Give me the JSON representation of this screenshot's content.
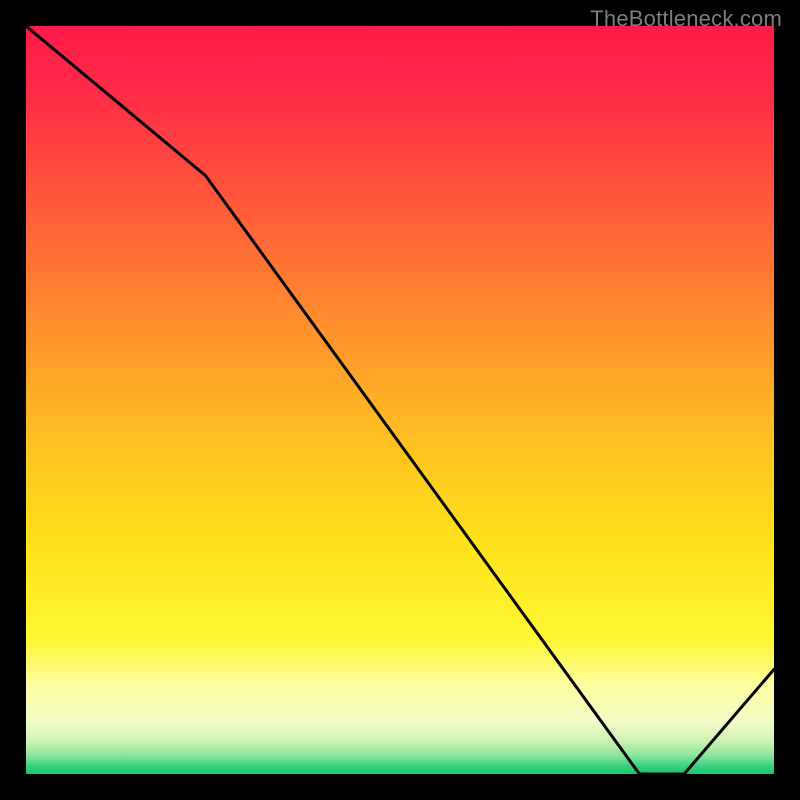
{
  "watermark": "TheBottleneck.com",
  "annotation_label": "",
  "colors": {
    "frame": "#000000",
    "curve": "#000000",
    "gradient_stops": [
      {
        "offset": 0.0,
        "color": "#ff1a4b"
      },
      {
        "offset": 0.1,
        "color": "#ff2e46"
      },
      {
        "offset": 0.24,
        "color": "#ff5a3a"
      },
      {
        "offset": 0.4,
        "color": "#ff8f2e"
      },
      {
        "offset": 0.55,
        "color": "#ffbf22"
      },
      {
        "offset": 0.7,
        "color": "#ffe31a"
      },
      {
        "offset": 0.82,
        "color": "#fff735"
      },
      {
        "offset": 0.88,
        "color": "#fdfca0"
      },
      {
        "offset": 0.93,
        "color": "#f4fbc8"
      },
      {
        "offset": 0.955,
        "color": "#cdf2b4"
      },
      {
        "offset": 0.975,
        "color": "#8be59a"
      },
      {
        "offset": 0.99,
        "color": "#35cf7e"
      },
      {
        "offset": 1.0,
        "color": "#17c96f"
      }
    ]
  },
  "chart_data": {
    "type": "line",
    "title": "",
    "xlabel": "",
    "ylabel": "",
    "xlim": [
      0,
      100
    ],
    "ylim": [
      0,
      100
    ],
    "x": [
      0,
      24,
      82,
      88,
      100
    ],
    "values": [
      100,
      80,
      0,
      0,
      14
    ],
    "annotation": {
      "x": 85,
      "y": 1.5,
      "text": ""
    }
  }
}
